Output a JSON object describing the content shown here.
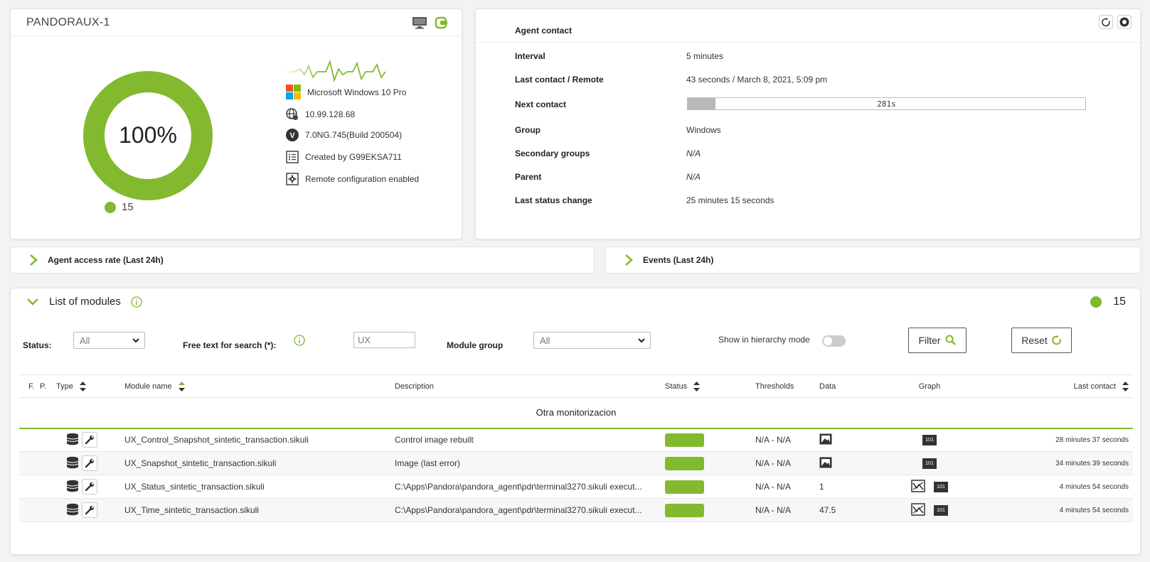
{
  "agent": {
    "name": "PANDORAUX-1",
    "percent": "100%",
    "percent_value": 100,
    "module_count": "15",
    "os": "Microsoft Windows 10 Pro",
    "ip": "10.99.128.68",
    "version": "7.0NG.745(Build 200504)",
    "created_by": "Created by G99EKSA711",
    "remote_config": "Remote configuration enabled"
  },
  "contact": {
    "title": "Agent contact",
    "rows": [
      {
        "label": "Interval",
        "value": "5 minutes"
      },
      {
        "label": "Last contact / Remote",
        "value": "43 seconds / March 8, 2021, 5:09 pm"
      },
      {
        "label": "Next contact",
        "value": "281s",
        "progress": 0.07
      },
      {
        "label": "Group",
        "value": "Windows"
      },
      {
        "label": "Secondary groups",
        "value": "N/A"
      },
      {
        "label": "Parent",
        "value": "N/A"
      },
      {
        "label": "Last status change",
        "value": "25 minutes 15 seconds"
      }
    ]
  },
  "sections": {
    "access_rate": "Agent access rate (Last 24h)",
    "events": "Events (Last 24h)"
  },
  "modules": {
    "title": "List of modules",
    "count": "15",
    "filters": {
      "status_label": "Status:",
      "status_value": "All",
      "search_label": "Free text for search (*):",
      "search_value": "UX",
      "group_label": "Module group",
      "group_value": "All",
      "hierarchy_label": "Show in hierarchy mode",
      "filter_button": "Filter",
      "reset_button": "Reset"
    },
    "columns": [
      "F.",
      "P.",
      "Type",
      "Module name",
      "Description",
      "Status",
      "Thresholds",
      "Data",
      "Graph",
      "Last contact"
    ],
    "group_name": "Otra monitorizacion",
    "rows": [
      {
        "name": "UX_Control_Snapshot_sintetic_transaction.sikuli",
        "description": "Control image rebuilt",
        "thresholds": "N/A - N/A",
        "data": "",
        "data_icon": "image-icon",
        "graph": "101",
        "last_contact": "28 minutes 37 seconds"
      },
      {
        "name": "UX_Snapshot_sintetic_transaction.sikuli",
        "description": "Image (last error)",
        "thresholds": "N/A - N/A",
        "data": "",
        "data_icon": "image-icon",
        "graph": "101",
        "last_contact": "34 minutes 39 seconds"
      },
      {
        "name": "UX_Status_sintetic_transaction.sikuli",
        "description": "C:\\Apps\\Pandora\\pandora_agent\\pdr\\terminal3270.sikuli execut...",
        "thresholds": "N/A - N/A",
        "data": "1",
        "data_icon": "",
        "graph": "101",
        "last_contact": "4 minutes 54 seconds"
      },
      {
        "name": "UX_Time_sintetic_transaction.sikuli",
        "description": "C:\\Apps\\Pandora\\pandora_agent\\pdr\\terminal3270.sikuli execut...",
        "thresholds": "N/A - N/A",
        "data": "47.5",
        "data_icon": "",
        "graph": "101",
        "last_contact": "4 minutes 54 seconds"
      }
    ]
  },
  "colors": {
    "accent": "#82b92e"
  }
}
